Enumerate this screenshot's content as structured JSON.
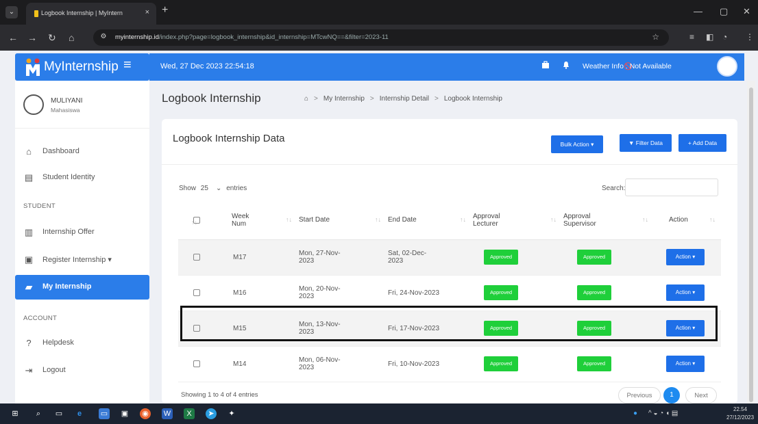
{
  "browser": {
    "tab_title": "Logbook Internship | MyIntern",
    "tab_close": "×",
    "new_tab": "+",
    "url_domain": "myinternship.id",
    "url_path": "/index.php?page=logbook_internship&id_internship=MTcwNQ==&filter=2023-11"
  },
  "app": {
    "brand": "MyInternship",
    "datetime": "Wed, 27 Dec 2023    22:54:18",
    "weather_label": "Weather Info :",
    "weather_value": "Not Available"
  },
  "profile": {
    "name": "MULIYANI",
    "role": "Mahasiswa"
  },
  "sidebar": {
    "items": [
      {
        "label": "Dashboard"
      },
      {
        "label": "Student Identity"
      },
      {
        "label": "Internship Offer"
      },
      {
        "label": "Register Internship"
      },
      {
        "label": "My Internship"
      },
      {
        "label": "Helpdesk"
      },
      {
        "label": "Logout"
      }
    ],
    "section_student": "STUDENT",
    "section_account": "ACCOUNT",
    "register_caret": "▾"
  },
  "page": {
    "title": "Logbook Internship",
    "breadcrumb": [
      "My Internship",
      "Internship Detail",
      "Logbook Internship"
    ]
  },
  "card": {
    "title": "Logbook Internship Data",
    "bulk_action": "Bulk Action ▾",
    "filter_data": "Filter Data",
    "add_data": "+ Add Data",
    "show_label": "Show",
    "entries_value": "25",
    "entries_label": "entries",
    "search_label": "Search:"
  },
  "table": {
    "columns": [
      "Week Num",
      "Start Date",
      "End Date",
      "Approval Lecturer",
      "Approval Supervisor",
      "Action"
    ],
    "rows": [
      {
        "week": "M17",
        "start": "Mon, 27-Nov-2023",
        "end": "Sat, 02-Dec-2023",
        "lecturer": "Approved",
        "supervisor": "Approved",
        "action": "Action ▾"
      },
      {
        "week": "M16",
        "start": "Mon, 20-Nov-2023",
        "end": "Fri, 24-Nov-2023",
        "lecturer": "Approved",
        "supervisor": "Approved",
        "action": "Action ▾"
      },
      {
        "week": "M15",
        "start": "Mon, 13-Nov-2023",
        "end": "Fri, 17-Nov-2023",
        "lecturer": "Approved",
        "supervisor": "Approved",
        "action": "Action ▾"
      },
      {
        "week": "M14",
        "start": "Mon, 06-Nov-2023",
        "end": "Fri, 10-Nov-2023",
        "lecturer": "Approved",
        "supervisor": "Approved",
        "action": "Action ▾"
      }
    ]
  },
  "pagination": {
    "info": "Showing 1 to 4 of 4 entries",
    "previous": "Previous",
    "current": "1",
    "next": "Next"
  },
  "taskbar": {
    "time": "22.54",
    "date": "27/12/2023"
  },
  "colors": {
    "primary": "#2b7de9",
    "approved": "#1fcf3a",
    "action": "#1e6fe8"
  }
}
